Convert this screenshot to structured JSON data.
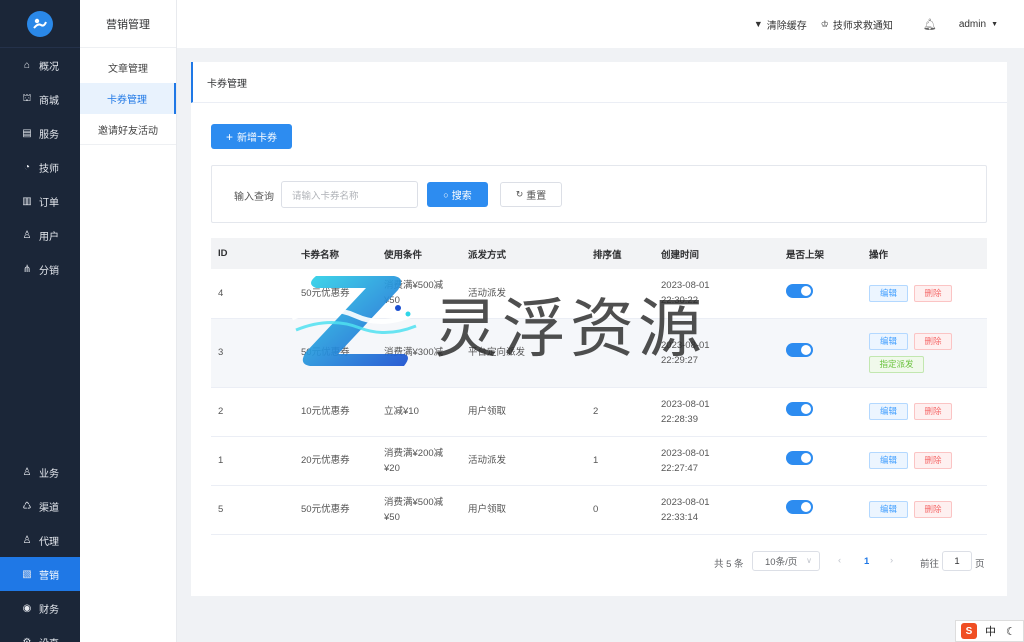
{
  "sidebar": {
    "items": [
      {
        "label": "概况",
        "icon": "home-icon",
        "glyph": "⌂"
      },
      {
        "label": "商城",
        "icon": "shop-icon",
        "glyph": "⛫"
      },
      {
        "label": "服务",
        "icon": "service-icon",
        "glyph": "▤"
      },
      {
        "label": "技师",
        "icon": "technician-icon",
        "glyph": "◔"
      },
      {
        "label": "订单",
        "icon": "order-icon",
        "glyph": "▥"
      },
      {
        "label": "用户",
        "icon": "user-icon",
        "glyph": "♙"
      },
      {
        "label": "分销",
        "icon": "distribution-icon",
        "glyph": "⋔"
      },
      {
        "label": "业务",
        "icon": "business-icon",
        "glyph": "♙"
      },
      {
        "label": "渠道",
        "icon": "channel-icon",
        "glyph": "♺"
      },
      {
        "label": "代理",
        "icon": "agent-icon",
        "glyph": "♙"
      },
      {
        "label": "营销",
        "icon": "marketing-icon",
        "glyph": "▧"
      },
      {
        "label": "财务",
        "icon": "finance-icon",
        "glyph": "◉"
      },
      {
        "label": "设直",
        "icon": "settings-icon",
        "glyph": "⚙"
      }
    ]
  },
  "submenu": {
    "title": "营销管理",
    "items": [
      "文章管理",
      "卡券管理",
      "邀请好友活动"
    ]
  },
  "header": {
    "clear_cache": "清除缓存",
    "sos_notice": "技师求救通知",
    "user": "admin"
  },
  "page": {
    "title": "卡券管理",
    "add_button": "新增卡券",
    "search_label": "输入查询",
    "search_placeholder": "请输入卡券名称",
    "search_button": "搜索",
    "reset_button": "重置"
  },
  "table": {
    "headers": [
      "ID",
      "卡券名称",
      "使用条件",
      "派发方式",
      "排序值",
      "创建时间",
      "是否上架",
      "操作"
    ],
    "rows": [
      {
        "id": "4",
        "name": "50元优惠券",
        "cond1": "消费满¥500减",
        "cond2": "¥50",
        "method": "活动派发",
        "sort": "",
        "date": "2023-08-01",
        "time": "22:30:22",
        "on": true
      },
      {
        "id": "3",
        "name": "50元优惠券",
        "cond1": "消费满¥300减",
        "cond2": "",
        "method": "平台定向派发",
        "sort": "",
        "date": "2023-08-01",
        "time": "22:29:27",
        "on": true
      },
      {
        "id": "2",
        "name": "10元优惠券",
        "cond1": "立减¥10",
        "cond2": "",
        "method": "用户领取",
        "sort": "2",
        "date": "2023-08-01",
        "time": "22:28:39",
        "on": true
      },
      {
        "id": "1",
        "name": "20元优惠券",
        "cond1": "消费满¥200减",
        "cond2": "¥20",
        "method": "活动派发",
        "sort": "1",
        "date": "2023-08-01",
        "time": "22:27:47",
        "on": true
      },
      {
        "id": "5",
        "name": "50元优惠券",
        "cond1": "消费满¥500减",
        "cond2": "¥50",
        "method": "用户领取",
        "sort": "0",
        "date": "2023-08-01",
        "time": "22:33:14",
        "on": true
      }
    ],
    "edit_label": "编辑",
    "delete_label": "删除",
    "assign_label": "指定派发"
  },
  "pagination": {
    "total": "共 5 条",
    "page_size": "10条/页",
    "current": "1",
    "goto_label": "前往",
    "goto_value": "1",
    "page_suffix": "页"
  },
  "watermark": {
    "text": "灵浮资源"
  },
  "ime": {
    "mode": "中"
  },
  "colors": {
    "primary": "#2d8cf0",
    "sidebar_bg": "#1b2638",
    "active": "#1f78e6"
  }
}
